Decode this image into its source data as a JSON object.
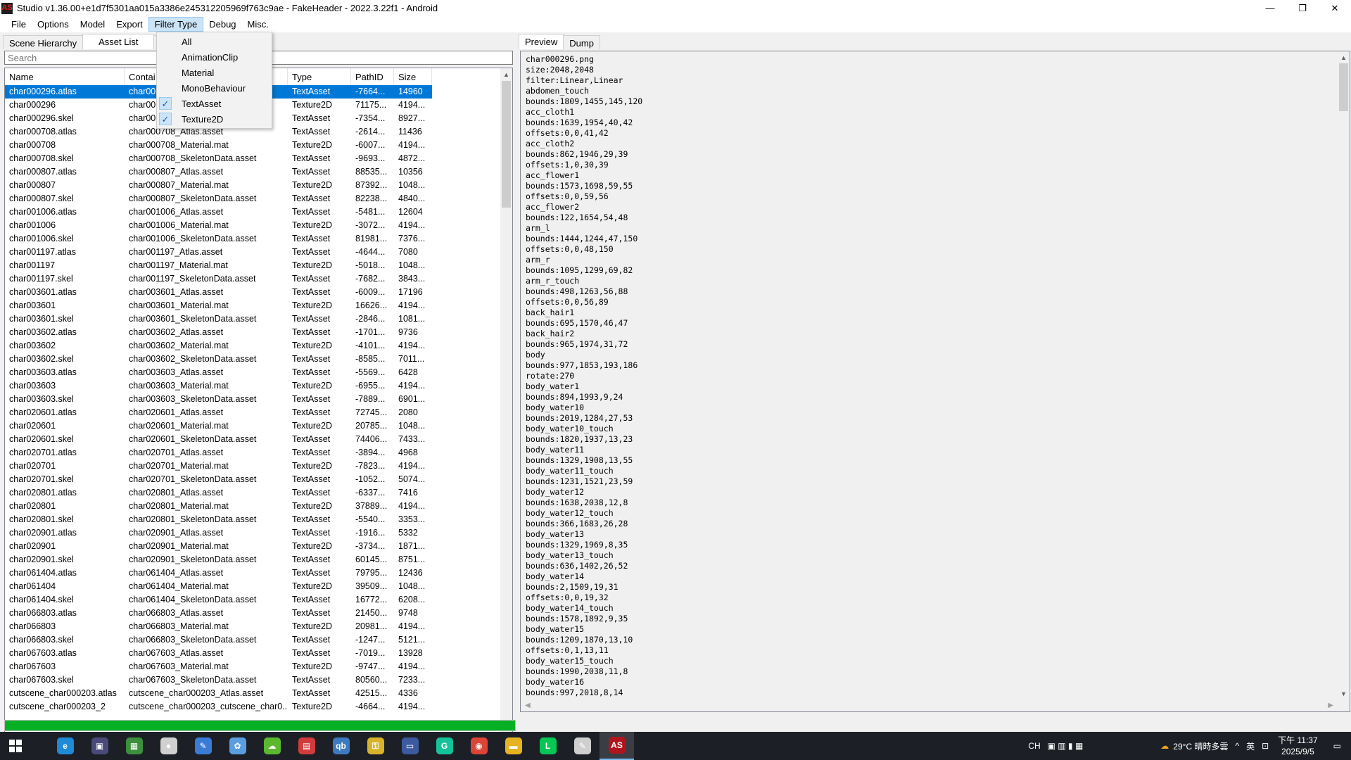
{
  "window": {
    "title": "Studio v1.36.00+e1d7f5301aa015a3386e245312205969f763c9ae - FakeHeader - 2022.3.22f1 - Android",
    "app_icon": "AS",
    "controls": [
      "—",
      "❐",
      "✕"
    ]
  },
  "menu": [
    "File",
    "Options",
    "Model",
    "Export",
    "Filter Type",
    "Debug",
    "Misc."
  ],
  "filter_menu": {
    "items": [
      {
        "label": "All",
        "checked": false
      },
      {
        "label": "AnimationClip",
        "checked": false
      },
      {
        "label": "Material",
        "checked": false
      },
      {
        "label": "MonoBehaviour",
        "checked": false
      },
      {
        "label": "TextAsset",
        "checked": true
      },
      {
        "label": "Texture2D",
        "checked": true
      }
    ],
    "check_glyph": "✓"
  },
  "left_tabs": [
    "Scene Hierarchy",
    "Asset List",
    "As"
  ],
  "search": {
    "placeholder": "Search",
    "value": ""
  },
  "columns": [
    "Name",
    "Contai",
    "Type",
    "PathID",
    "Size"
  ],
  "rows": [
    [
      "char000296.atlas",
      "char00",
      "TextAsset",
      "-7664...",
      "14960"
    ],
    [
      "char000296",
      "char00",
      "Texture2D",
      "71175...",
      "4194..."
    ],
    [
      "char000296.skel",
      "char00",
      "TextAsset",
      "-7354...",
      "8927..."
    ],
    [
      "char000708.atlas",
      "char000708_Atlas.asset",
      "TextAsset",
      "-2614...",
      "11436"
    ],
    [
      "char000708",
      "char000708_Material.mat",
      "Texture2D",
      "-6007...",
      "4194..."
    ],
    [
      "char000708.skel",
      "char000708_SkeletonData.asset",
      "TextAsset",
      "-9693...",
      "4872..."
    ],
    [
      "char000807.atlas",
      "char000807_Atlas.asset",
      "TextAsset",
      "88535...",
      "10356"
    ],
    [
      "char000807",
      "char000807_Material.mat",
      "Texture2D",
      "87392...",
      "1048..."
    ],
    [
      "char000807.skel",
      "char000807_SkeletonData.asset",
      "TextAsset",
      "82238...",
      "4840..."
    ],
    [
      "char001006.atlas",
      "char001006_Atlas.asset",
      "TextAsset",
      "-5481...",
      "12604"
    ],
    [
      "char001006",
      "char001006_Material.mat",
      "Texture2D",
      "-3072...",
      "4194..."
    ],
    [
      "char001006.skel",
      "char001006_SkeletonData.asset",
      "TextAsset",
      "81981...",
      "7376..."
    ],
    [
      "char001197.atlas",
      "char001197_Atlas.asset",
      "TextAsset",
      "-4644...",
      "7080"
    ],
    [
      "char001197",
      "char001197_Material.mat",
      "Texture2D",
      "-5018...",
      "1048..."
    ],
    [
      "char001197.skel",
      "char001197_SkeletonData.asset",
      "TextAsset",
      "-7682...",
      "3843..."
    ],
    [
      "char003601.atlas",
      "char003601_Atlas.asset",
      "TextAsset",
      "-6009...",
      "17196"
    ],
    [
      "char003601",
      "char003601_Material.mat",
      "Texture2D",
      "16626...",
      "4194..."
    ],
    [
      "char003601.skel",
      "char003601_SkeletonData.asset",
      "TextAsset",
      "-2846...",
      "1081..."
    ],
    [
      "char003602.atlas",
      "char003602_Atlas.asset",
      "TextAsset",
      "-1701...",
      "9736"
    ],
    [
      "char003602",
      "char003602_Material.mat",
      "Texture2D",
      "-4101...",
      "4194..."
    ],
    [
      "char003602.skel",
      "char003602_SkeletonData.asset",
      "TextAsset",
      "-8585...",
      "7011..."
    ],
    [
      "char003603.atlas",
      "char003603_Atlas.asset",
      "TextAsset",
      "-5569...",
      "6428"
    ],
    [
      "char003603",
      "char003603_Material.mat",
      "Texture2D",
      "-6955...",
      "4194..."
    ],
    [
      "char003603.skel",
      "char003603_SkeletonData.asset",
      "TextAsset",
      "-7889...",
      "6901..."
    ],
    [
      "char020601.atlas",
      "char020601_Atlas.asset",
      "TextAsset",
      "72745...",
      "2080"
    ],
    [
      "char020601",
      "char020601_Material.mat",
      "Texture2D",
      "20785...",
      "1048..."
    ],
    [
      "char020601.skel",
      "char020601_SkeletonData.asset",
      "TextAsset",
      "74406...",
      "7433..."
    ],
    [
      "char020701.atlas",
      "char020701_Atlas.asset",
      "TextAsset",
      "-3894...",
      "4968"
    ],
    [
      "char020701",
      "char020701_Material.mat",
      "Texture2D",
      "-7823...",
      "4194..."
    ],
    [
      "char020701.skel",
      "char020701_SkeletonData.asset",
      "TextAsset",
      "-1052...",
      "5074..."
    ],
    [
      "char020801.atlas",
      "char020801_Atlas.asset",
      "TextAsset",
      "-6337...",
      "7416"
    ],
    [
      "char020801",
      "char020801_Material.mat",
      "Texture2D",
      "37889...",
      "4194..."
    ],
    [
      "char020801.skel",
      "char020801_SkeletonData.asset",
      "TextAsset",
      "-5540...",
      "3353..."
    ],
    [
      "char020901.atlas",
      "char020901_Atlas.asset",
      "TextAsset",
      "-1916...",
      "5332"
    ],
    [
      "char020901",
      "char020901_Material.mat",
      "Texture2D",
      "-3734...",
      "1871..."
    ],
    [
      "char020901.skel",
      "char020901_SkeletonData.asset",
      "TextAsset",
      "60145...",
      "8751..."
    ],
    [
      "char061404.atlas",
      "char061404_Atlas.asset",
      "TextAsset",
      "79795...",
      "12436"
    ],
    [
      "char061404",
      "char061404_Material.mat",
      "Texture2D",
      "39509...",
      "1048..."
    ],
    [
      "char061404.skel",
      "char061404_SkeletonData.asset",
      "TextAsset",
      "16772...",
      "6208..."
    ],
    [
      "char066803.atlas",
      "char066803_Atlas.asset",
      "TextAsset",
      "21450...",
      "9748"
    ],
    [
      "char066803",
      "char066803_Material.mat",
      "Texture2D",
      "20981...",
      "4194..."
    ],
    [
      "char066803.skel",
      "char066803_SkeletonData.asset",
      "TextAsset",
      "-1247...",
      "5121..."
    ],
    [
      "char067603.atlas",
      "char067603_Atlas.asset",
      "TextAsset",
      "-7019...",
      "13928"
    ],
    [
      "char067603",
      "char067603_Material.mat",
      "Texture2D",
      "-9747...",
      "4194..."
    ],
    [
      "char067603.skel",
      "char067603_SkeletonData.asset",
      "TextAsset",
      "80560...",
      "7233..."
    ],
    [
      "cutscene_char000203.atlas",
      "cutscene_char000203_Atlas.asset",
      "TextAsset",
      "42515...",
      "4336"
    ],
    [
      "cutscene_char000203_2",
      "cutscene_char000203_cutscene_char0...",
      "Texture2D",
      "-4664...",
      "4194..."
    ]
  ],
  "selected_row": 0,
  "progress": {
    "value": 1.0,
    "color": "#06b025"
  },
  "right_tabs": [
    "Preview",
    "Dump"
  ],
  "preview_lines": [
    "char000296.png",
    "size:2048,2048",
    "filter:Linear,Linear",
    "abdomen_touch",
    "bounds:1809,1455,145,120",
    "acc_cloth1",
    "bounds:1639,1954,40,42",
    "offsets:0,0,41,42",
    "acc_cloth2",
    "bounds:862,1946,29,39",
    "offsets:1,0,30,39",
    "acc_flower1",
    "bounds:1573,1698,59,55",
    "offsets:0,0,59,56",
    "acc_flower2",
    "bounds:122,1654,54,48",
    "arm_l",
    "bounds:1444,1244,47,150",
    "offsets:0,0,48,150",
    "arm_r",
    "bounds:1095,1299,69,82",
    "arm_r_touch",
    "bounds:498,1263,56,88",
    "offsets:0,0,56,89",
    "back_hair1",
    "bounds:695,1570,46,47",
    "back_hair2",
    "bounds:965,1974,31,72",
    "body",
    "bounds:977,1853,193,186",
    "rotate:270",
    "body_water1",
    "bounds:894,1993,9,24",
    "body_water10",
    "bounds:2019,1284,27,53",
    "body_water10_touch",
    "bounds:1820,1937,13,23",
    "body_water11",
    "bounds:1329,1908,13,55",
    "body_water11_touch",
    "bounds:1231,1521,23,59",
    "body_water12",
    "bounds:1638,2038,12,8",
    "body_water12_touch",
    "bounds:366,1683,26,28",
    "body_water13",
    "bounds:1329,1969,8,35",
    "body_water13_touch",
    "bounds:636,1402,26,52",
    "body_water14",
    "bounds:2,1509,19,31",
    "offsets:0,0,19,32",
    "body_water14_touch",
    "bounds:1578,1892,9,35",
    "body_water15",
    "bounds:1209,1870,13,10",
    "offsets:0,1,13,11",
    "body_water15_touch",
    "bounds:1990,2038,11,8",
    "body_water16",
    "bounds:997,2018,8,14"
  ],
  "taskbar": {
    "apps": [
      {
        "icon": "edge-icon",
        "color": "#1f8ad6",
        "glyph": "e"
      },
      {
        "icon": "app-icon",
        "color": "#4a4a7a",
        "glyph": "▣"
      },
      {
        "icon": "gallery-icon",
        "color": "#3c8f3c",
        "glyph": "▦"
      },
      {
        "icon": "pokeball-icon",
        "color": "#d0d0d0",
        "glyph": "●"
      },
      {
        "icon": "calendar-icon",
        "color": "#3a7bd5",
        "glyph": "✎"
      },
      {
        "icon": "paint-icon",
        "color": "#5a9ee0",
        "glyph": "✿"
      },
      {
        "icon": "cloud-icon",
        "color": "#5cb82e",
        "glyph": "☁"
      },
      {
        "icon": "news-icon",
        "color": "#d23b3b",
        "glyph": "▤"
      },
      {
        "icon": "qb-icon",
        "color": "#3d7ac0",
        "glyph": "qb"
      },
      {
        "icon": "key-icon",
        "color": "#d8b22a",
        "glyph": "⚿"
      },
      {
        "icon": "monitor-icon",
        "color": "#3b5aa0",
        "glyph": "▭"
      },
      {
        "icon": "grammarly-icon",
        "color": "#15c39a",
        "glyph": "G"
      },
      {
        "icon": "chrome-icon",
        "color": "#db4437",
        "glyph": "◉"
      },
      {
        "icon": "folder-icon",
        "color": "#e6b422",
        "glyph": "▬"
      },
      {
        "icon": "line-icon",
        "color": "#06c755",
        "glyph": "L"
      },
      {
        "icon": "notepad-icon",
        "color": "#cfcfcf",
        "glyph": "✎"
      },
      {
        "icon": "assetstudio-icon",
        "color": "#b0151d",
        "glyph": "AS"
      }
    ],
    "ime": "CH",
    "weather": "29°C 晴時多雲",
    "lang": "英",
    "time": "下午 11:37",
    "date": "2025/9/5"
  }
}
